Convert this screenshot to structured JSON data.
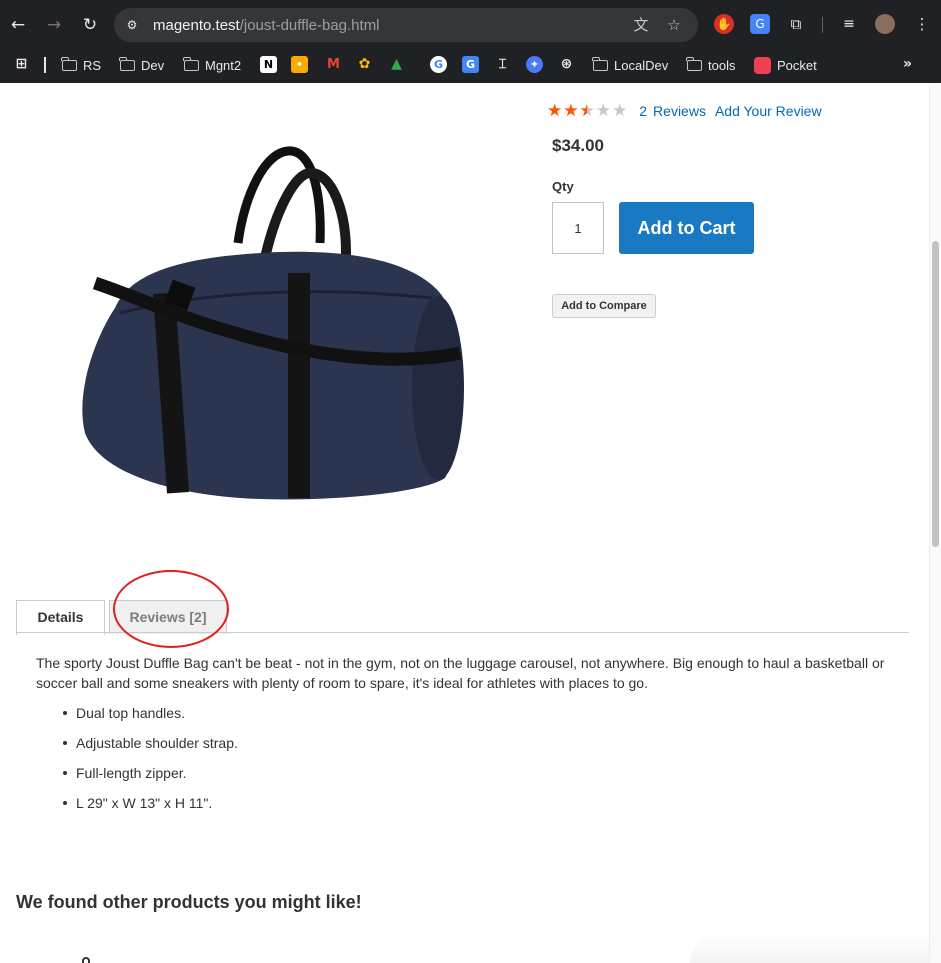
{
  "browser": {
    "url_host": "magento.test",
    "url_path": "/joust-duffle-bag.html",
    "bookmarks": [
      "RS",
      "Dev",
      "Mgnt2",
      "LocalDev",
      "tools",
      "Pocket"
    ]
  },
  "product": {
    "rating": {
      "filled_stars": 2.5,
      "total_stars": 5,
      "review_count": "2",
      "reviews_label": "Reviews",
      "add_review": "Add Your Review"
    },
    "price": "$34.00",
    "qty_label": "Qty",
    "qty_value": "1",
    "add_to_cart": "Add to Cart",
    "add_to_compare": "Add to Compare",
    "image_color": "#2c3550"
  },
  "tabs": [
    {
      "label": "Details",
      "active": true
    },
    {
      "label": "Reviews [2]",
      "active": false
    }
  ],
  "details": {
    "description": "The sporty Joust Duffle Bag can't be beat - not in the gym, not on the luggage carousel, not anywhere. Big enough to haul a basketball or soccer ball and some sneakers with plenty of room to spare, it's ideal for athletes with places to go.",
    "bullets": [
      "Dual top handles.",
      "Adjustable shoulder strap.",
      "Full-length zipper.",
      "L 29\" x W 13\" x H 11\"."
    ]
  },
  "related": {
    "title": "We found other products you might like!"
  },
  "colors": {
    "accent": "#1979c3",
    "link": "#006bb4",
    "star": "#ff5501",
    "annotation": "#e02020"
  }
}
